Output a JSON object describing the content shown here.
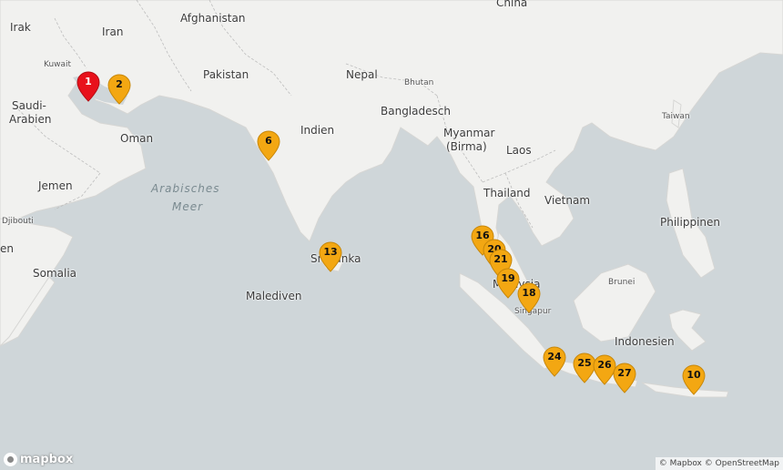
{
  "labels": {
    "afghanistan": "Afghanistan",
    "china": "China",
    "irak": "Irak",
    "iran": "Iran",
    "kuwait": "Kuwait",
    "pakistan": "Pakistan",
    "nepal": "Nepal",
    "bhutan": "Bhutan",
    "saudi1": "Saudi-",
    "saudi2": "Arabien",
    "oman": "Oman",
    "bangladesch": "Bangladesch",
    "indien": "Indien",
    "taiwan": "Taiwan",
    "myanmar1": "Myanmar",
    "myanmar2": "(Birma)",
    "laos": "Laos",
    "jemen": "Jemen",
    "arabisches": "Arabisches",
    "meer": "Meer",
    "thailand": "Thailand",
    "vietnam": "Vietnam",
    "philippinen": "Philippinen",
    "djibouti": "Djibouti",
    "en": "en",
    "somalia": "Somalia",
    "srilanka": "Sri Lanka",
    "malaysia": "Malaysia",
    "brunei": "Brunei",
    "malediven": "Malediven",
    "singapur": "Singapur",
    "indonesien": "Indonesien"
  },
  "markers": [
    {
      "id": "1",
      "color": "#e8111b"
    },
    {
      "id": "2",
      "color": "#f3a712"
    },
    {
      "id": "6",
      "color": "#f3a712"
    },
    {
      "id": "13",
      "color": "#f3a712"
    },
    {
      "id": "16",
      "color": "#f3a712"
    },
    {
      "id": "20",
      "color": "#f3a712"
    },
    {
      "id": "21",
      "color": "#f3a712"
    },
    {
      "id": "19",
      "color": "#f3a712"
    },
    {
      "id": "18",
      "color": "#f3a712"
    },
    {
      "id": "24",
      "color": "#f3a712"
    },
    {
      "id": "25",
      "color": "#f3a712"
    },
    {
      "id": "26",
      "color": "#f3a712"
    },
    {
      "id": "27",
      "color": "#f3a712"
    },
    {
      "id": "10",
      "color": "#f3a712"
    }
  ],
  "logo_text": "mapbox",
  "attribution": "© Mapbox © OpenStreetMap",
  "colors": {
    "water": "#cfd6d9",
    "land": "#f1f1ef",
    "border": "#b9b9b9"
  }
}
